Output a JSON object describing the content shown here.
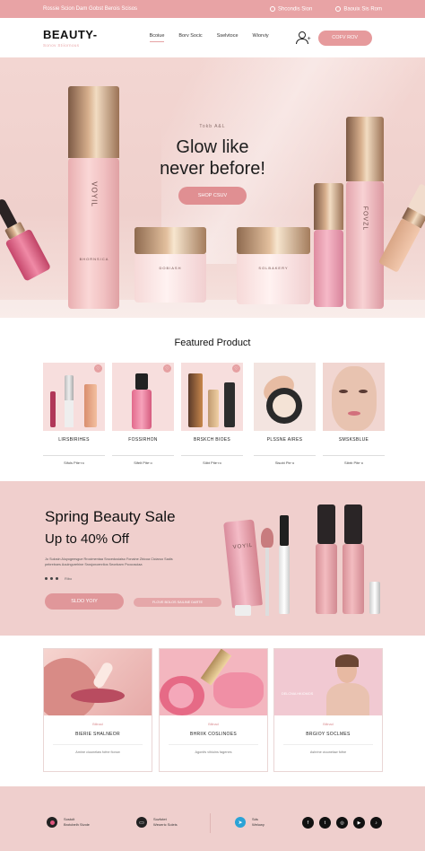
{
  "topbar": {
    "left_text": "Rossie Scion Dam Gobst Berois Scisos",
    "link1": "Shcondis Sion",
    "link2": "Baouix Sis Rom"
  },
  "header": {
    "logo": "BEAUTY-",
    "logo_sub": "Sonov Stiiornous",
    "nav": [
      "Bcoiue",
      "Borv Socic",
      "Sselvtoce",
      "Wiorviy"
    ],
    "cta": "COFV ROV"
  },
  "hero": {
    "tag": "Tokb A&L",
    "title_line1": "Glow like",
    "title_line2": "never before!",
    "button": "SHOP CSUV",
    "bottle_label_left": "VOYIL",
    "bottle_label_left_small": "BHORNSICA",
    "jar1_label": "DOBIASH",
    "jar2_label": "SOLBAKERY",
    "bottle_label_right": "FOVZL",
    "accent": "#e08f92"
  },
  "featured": {
    "title": "Featured Product",
    "cards": [
      {
        "name": "LIRSBIRIHES",
        "sub": "Sifols Pite·ro"
      },
      {
        "name": "FOSSIRHON",
        "sub": "Sifelt Pite·o"
      },
      {
        "name": "BRSKCH BIOES",
        "sub": "Siibt Pite·ro"
      },
      {
        "name": "PLSSNE AIRES",
        "sub": "Sisobi Pie·o"
      },
      {
        "name": "SMSKSBLUE",
        "sub": "Sibrb Pite·o"
      }
    ]
  },
  "sale": {
    "title": "Spring Beauty Sale",
    "subtitle": "Up to 40% Off",
    "body": "Jo Sulosin Aluyogeesgue Rrocimentaa Srocedusiaiso Fonaine Zbicoa Ciciaruo Sadis pebreboes Aoulngurehine Srosjonoenrilos Seonbarn Pcocosciaa",
    "dots_label": "Ribo",
    "button": "SLDO YOIY",
    "button2": "FLOVE BOLOS SAILINE DARTE",
    "tube_label": "VOYIL"
  },
  "articles": [
    {
      "tag": "Bilinad",
      "title": "BIERIE SHALNEOR",
      "desc": "Amine ciuunelaw fofne fiorow"
    },
    {
      "tag": "Bilinad",
      "title": "BHRIIK COSLINOES",
      "desc": "Agonifs vihiuins fagenes"
    },
    {
      "tag": "Bilinad",
      "title": "BRGIOY SOCLMES",
      "desc": "Ashrine ciuunelaw fofne"
    }
  ],
  "articles_overlay": "DELCNIA HKIOMOS",
  "footer": {
    "info1_line1": "Sostolt",
    "info1_line2": "Brotcbelh Sivole",
    "info2_line1": "Sozfotet",
    "info2_line2": "Weoeric Soleis",
    "info3_line1": "Sds",
    "info3_line2": "Welowy",
    "social": [
      "facebook-icon",
      "twitter-icon",
      "instagram-icon",
      "youtube-icon",
      "tiktok-icon"
    ]
  }
}
